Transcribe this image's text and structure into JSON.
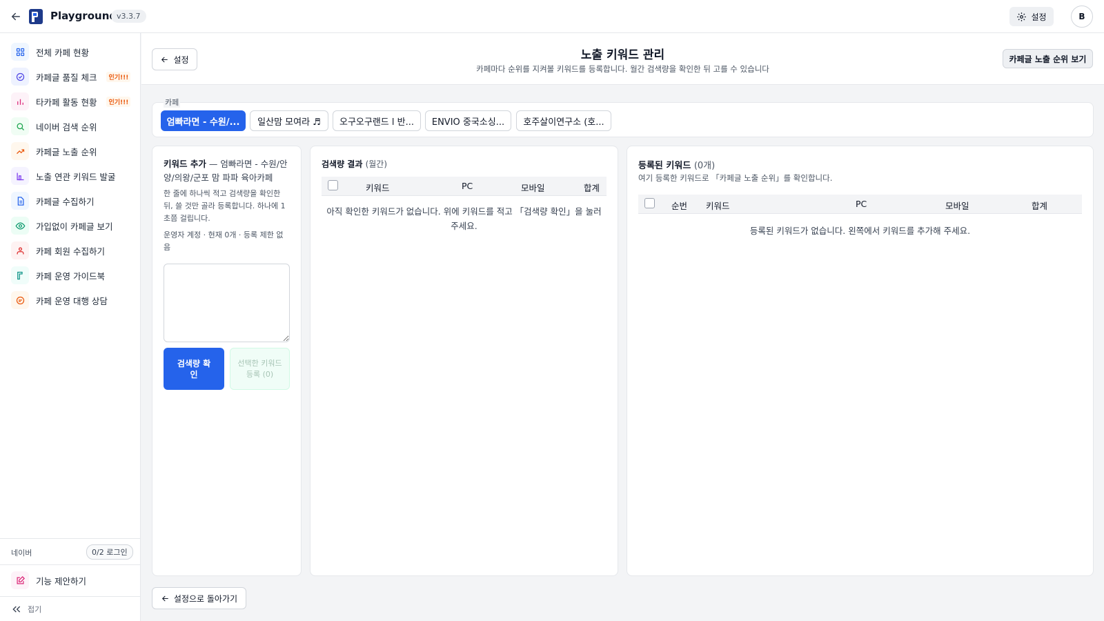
{
  "app": {
    "title": "Playground",
    "version": "v3.3.7"
  },
  "topbar": {
    "settings_label": "설정",
    "avatar_initial": "B"
  },
  "sidebar": {
    "items": [
      {
        "label": "전체 카페 현황",
        "icon": "grid-icon",
        "hot": ""
      },
      {
        "label": "카페글 품질 체크",
        "icon": "check-circle-icon",
        "hot": "인기!!!"
      },
      {
        "label": "타카페 활동 현황",
        "icon": "bar-chart-icon",
        "hot": "인기!!!"
      },
      {
        "label": "네이버 검색 순위",
        "icon": "search-icon",
        "hot": ""
      },
      {
        "label": "카페글 노출 순위",
        "icon": "trending-up-icon",
        "hot": ""
      },
      {
        "label": "노출 연관 키워드 발굴",
        "icon": "chart-columns-icon",
        "hot": ""
      },
      {
        "label": "카페글 수집하기",
        "icon": "document-icon",
        "hot": ""
      },
      {
        "label": "가입없이 카페글 보기",
        "icon": "eye-icon",
        "hot": ""
      },
      {
        "label": "카페 회원 수집하기",
        "icon": "users-icon",
        "hot": ""
      },
      {
        "label": "카페 운영 가이드북",
        "icon": "book-icon",
        "hot": ""
      },
      {
        "label": "카페 운영 대행 상담",
        "icon": "chat-icon",
        "hot": ""
      }
    ],
    "naver_label": "네이버",
    "naver_badge": "0/2 로그인",
    "suggest_label": "기능 제안하기",
    "collapse_label": "접기"
  },
  "header": {
    "back_label": "설정",
    "title": "노출 키워드 관리",
    "subtitle": "카페마다 순위를 지켜볼 키워드를 등록합니다. 월간 검색량을 확인한 뒤 고를 수 있습니다",
    "rank_button": "카페글 노출 순위 보기"
  },
  "cafe": {
    "label": "카페",
    "tabs": [
      "엄빠라면 - 수원/...",
      "일산맘 모여라 ♬",
      "오구오구랜드 l 반...",
      "ENVIO 중국소싱...",
      "호주살이연구소 (호..."
    ]
  },
  "keyword_add": {
    "title": "키워드 추가",
    "cafe_name": "— 엄빠라면 - 수원/안양/의왕/군포 맘 파파 육아카페",
    "desc": "한 줄에 하나씩 적고 검색량을 확인한 뒤, 쓸 것만 골라 등록합니다. 하나에 1초쯤 걸립니다.",
    "limit": "운영자 계정 · 현재 0개 · 등록 제한 없음",
    "textarea_value": "",
    "check_button": "검색량 확인",
    "register_button": "선택한 키워드 등록 (0)"
  },
  "search_result": {
    "title": "검색량 결과",
    "period": "(월간)",
    "columns": [
      "키워드",
      "PC",
      "모바일",
      "합계"
    ],
    "empty": "아직 확인한 키워드가 없습니다. 위에 키워드를 적고 「검색량 확인」을 눌러 주세요."
  },
  "registered": {
    "title": "등록된 키워드",
    "count": "(0개)",
    "sub": "여기 등록한 키워드로 「카페글 노출 순위」를 확인합니다.",
    "columns": [
      "순번",
      "키워드",
      "PC",
      "모바일",
      "합계"
    ],
    "empty": "등록된 키워드가 없습니다. 왼쪽에서 키워드를 추가해 주세요."
  },
  "footer": {
    "back_button": "설정으로 돌아가기"
  },
  "colors": {
    "primary": "#2563eb",
    "hot": "#ea580c"
  }
}
